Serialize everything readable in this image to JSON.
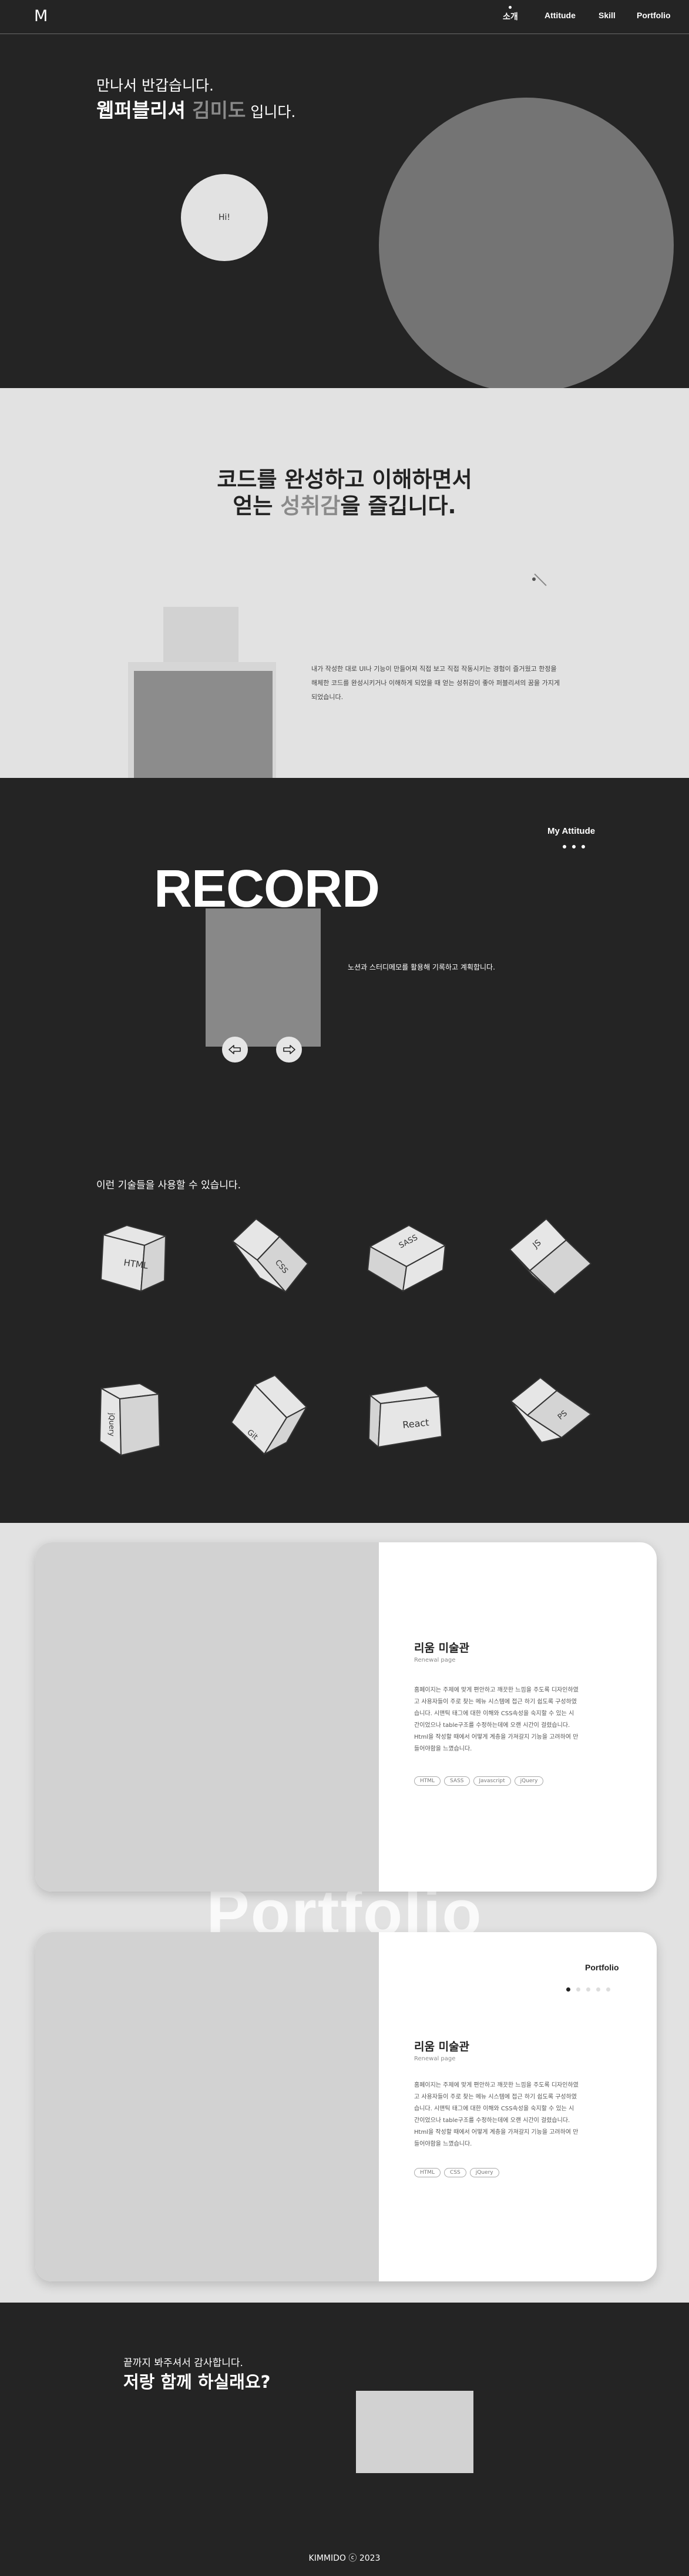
{
  "header": {
    "logo": "M",
    "nav": [
      "소개",
      "Attitude",
      "Skill",
      "Portfolio"
    ]
  },
  "intro": {
    "greeting": "만나서 반갑습니다.",
    "headline_prefix": "웹퍼블리셔 ",
    "headline_name": "김미도",
    "headline_suffix": " 입니다.",
    "circle_label": "Hi!"
  },
  "passion": {
    "title_line1": "코드를 완성하고 이해하면서",
    "title_line2_prefix": "얻는 ",
    "title_line2_accent": "성취감",
    "title_line2_suffix": "을 즐깁니다.",
    "description": "내가 작성한 대로 UI나 기능이 만들어져 직접 보고 직접 작동시키는 경험이 즐거웠고 한정을 해체한 코드를 완성시키거나 이해하게 되었을 때 얻는 성취감이 좋아 퍼블리셔의 꿈을 가지게 되었습니다."
  },
  "record": {
    "attitude_title": "My Attitude",
    "word": "RECORD",
    "description": "노션과 스터디메모를 활용해 기록하고 계획합니다.",
    "prev_icon": "arrow-left-icon",
    "next_icon": "arrow-right-icon"
  },
  "skills": {
    "title": "이런 기술들을 사용할 수 있습니다.",
    "items": [
      "HTML",
      "CSS",
      "SASS",
      "JS",
      "jQuery",
      "Git",
      "React",
      "PS"
    ]
  },
  "portfolio": {
    "watermark": "Portfolio",
    "label": "Portfolio",
    "cards": [
      {
        "title": "리움 미술관",
        "subtitle": "Renewal page",
        "description": "홈페이지는 주제에 맞게 편안하고 깨끗한 느낌을 주도록 디자인하였고 사용자들이 주로 찾는 메뉴 시스템에 접근 하기 쉽도록 구성하였습니다. 시맨틱 태그에 대한 이해와 CSS속성을 숙지할 수 있는 시간이었으나 table구조를 수정하는데에 오랜 시간이 걸렸습니다. Html을 작성할 때에서 어떻게 계층을 가져갈지 기능을 고려하여 만들어야함을 느꼈습니다.",
        "tags": [
          "HTML",
          "SASS",
          "Javascript",
          "jQuery"
        ]
      },
      {
        "title": "리움 미술관",
        "subtitle": "Renewal page",
        "description": "홈페이지는 주제에 맞게 편안하고 깨끗한 느낌을 주도록 디자인하였고 사용자들이 주로 찾는 메뉴 시스템에 접근 하기 쉽도록 구성하였습니다. 시맨틱 태그에 대한 이해와 CSS속성을 숙지할 수 있는 시간이었으나 table구조를 수정하는데에 오랜 시간이 걸렸습니다. Html을 작성할 때에서 어떻게 계층을 가져갈지 기능을 고려하여 만들어야함을 느꼈습니다.",
        "tags": [
          "HTML",
          "CSS",
          "jQuery"
        ]
      }
    ]
  },
  "contact": {
    "thanks": "끝까지 봐주셔서 감사합니다.",
    "headline": "저랑 함께 하실래요?",
    "footer": "KIMMIDO ⓒ 2023"
  }
}
